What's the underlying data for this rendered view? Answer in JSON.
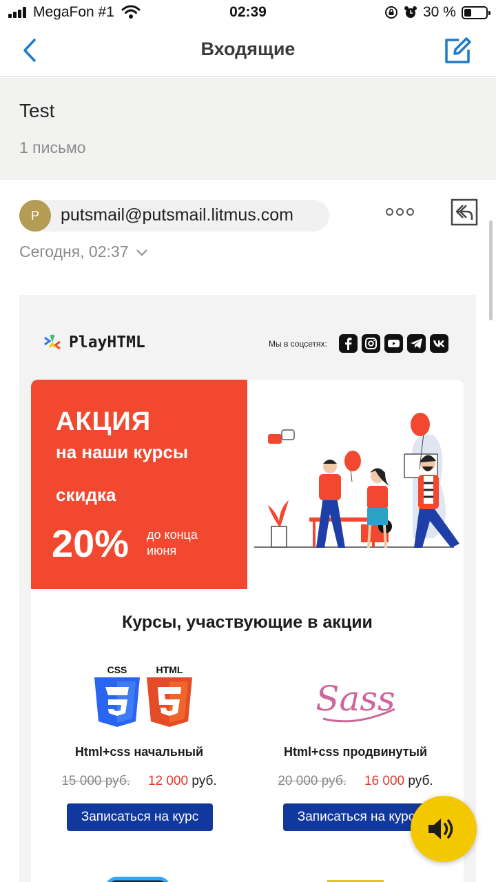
{
  "status_bar": {
    "carrier": "MegaFon #1",
    "time": "02:39",
    "battery_percent": "30 %"
  },
  "nav": {
    "title": "Входящие",
    "back_icon": "chevron-left-icon",
    "compose_icon": "compose-icon"
  },
  "thread": {
    "subject": "Test",
    "count": "1 письмо"
  },
  "message": {
    "avatar_letter": "P",
    "sender": "putsmail@putsmail.litmus.com",
    "date": "Сегодня, 02:37"
  },
  "email": {
    "brand": "PlayHTML",
    "social_label": "Мы в соцсетях:",
    "social_icons": [
      "facebook-icon",
      "instagram-icon",
      "youtube-icon",
      "telegram-icon",
      "vk-icon"
    ],
    "promo": {
      "title": "АКЦИЯ",
      "line2": "на наши курсы",
      "line3": "скидка",
      "percent": "20%",
      "until": "до конца июня"
    },
    "courses_title": "Курсы, участвующие в акции",
    "courses": [
      {
        "name": "Html+css начальный",
        "old_price": "15 000 руб.",
        "new_price": "12 000",
        "currency": "руб.",
        "button": "Записаться на курс",
        "logo_labels": [
          "CSS",
          "HTML"
        ]
      },
      {
        "name": "Html+css продвинутый",
        "old_price": "20 000 руб.",
        "new_price": "16 000",
        "currency": "руб.",
        "button": "Записаться на курс",
        "logo_labels": [
          "Sass"
        ]
      }
    ]
  },
  "colors": {
    "accent": "#1f7ac7",
    "promo_red": "#f2482f",
    "button_blue": "#11389c",
    "price_red": "#e2372a",
    "sound_button": "#f4c800"
  }
}
